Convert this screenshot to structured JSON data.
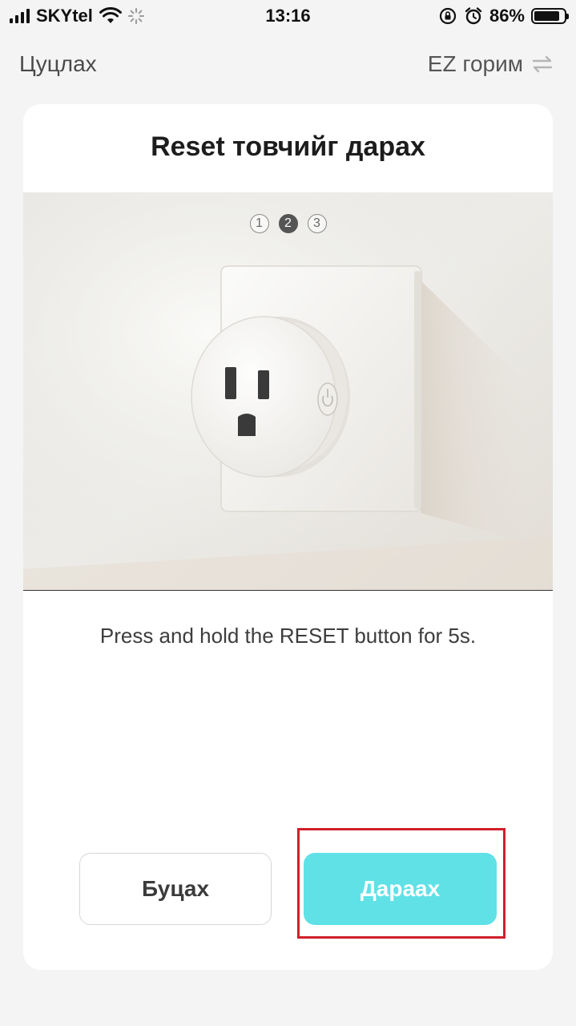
{
  "status_bar": {
    "carrier": "SKYtel",
    "time": "13:16",
    "battery_percent": "86%",
    "battery_level": 0.86,
    "icons": [
      "signal-icon",
      "wifi-icon",
      "activity-spinner-icon",
      "rotation-lock-icon",
      "alarm-icon",
      "battery-icon"
    ]
  },
  "nav": {
    "cancel_label": "Цуцлах",
    "mode_label": "EZ горим",
    "mode_icon": "swap-arrows-icon"
  },
  "card": {
    "title": "Reset товчийг дарах",
    "steps": [
      {
        "label": "1",
        "active": false
      },
      {
        "label": "2",
        "active": true
      },
      {
        "label": "3",
        "active": false
      }
    ],
    "image_icon": "smart-plug-illustration",
    "instruction": "Press and hold the RESET button for 5s."
  },
  "actions": {
    "back_label": "Буцах",
    "next_label": "Дараах"
  },
  "colors": {
    "accent": "#5fe1e6",
    "highlight": "#d0202a",
    "background": "#f4f4f4"
  }
}
